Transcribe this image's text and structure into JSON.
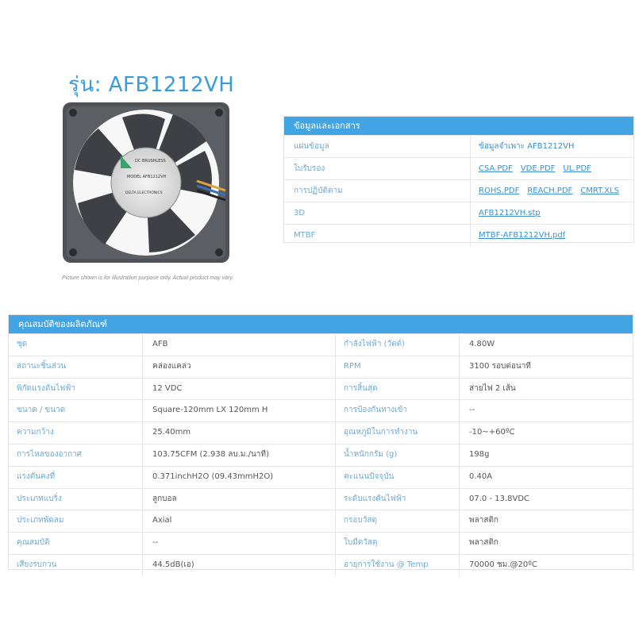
{
  "product": {
    "title": "รุ่น: AFB1212VH",
    "disclaimer": "Picture shown is for illustration purpose only. Actual product may vary.",
    "label_text": [
      "DC BRUSHLESS",
      "MODEL AFB1212VH",
      "DELTA ELECTRONICS"
    ]
  },
  "docs": {
    "header": "ข้อมูลและเอกสาร",
    "rows": [
      {
        "label": "แผ่นข้อมูล",
        "values": [
          "ข้อมูลจำเพาะ AFB1212VH"
        ],
        "links": false
      },
      {
        "label": "ใบรับรอง",
        "values": [
          "CSA.PDF",
          "VDE.PDF",
          "UL.PDF"
        ],
        "links": true
      },
      {
        "label": "การปฏิบัติตาม",
        "values": [
          "ROHS.PDF",
          "REACH.PDF",
          "CMRT.XLS"
        ],
        "links": true
      },
      {
        "label": "3D",
        "values": [
          "AFB1212VH.stp"
        ],
        "links": true
      },
      {
        "label": "MTBF",
        "values": [
          "MTBF-AFB1212VH.pdf"
        ],
        "links": true
      }
    ]
  },
  "props": {
    "header": "คุณสมบัติของผลิตภัณฑ์",
    "rows": [
      [
        "ชุด",
        "AFB",
        "กำลังไฟฟ้า (วัตต์)",
        "4.80W"
      ],
      [
        "สถานะชิ้นส่วน",
        "คล่องแคล่ว",
        "RPM",
        "3100 รอบต่อนาที"
      ],
      [
        "พิกัดแรงดันไฟฟ้า",
        "12 VDC",
        "การสิ้นสุด",
        "สายไฟ 2 เส้น"
      ],
      [
        "ขนาด / ขนาด",
        "Square-120mm LX 120mm H",
        "การป้องกันทางเข้า",
        "--"
      ],
      [
        "ความกว้าง",
        "25.40mm",
        "อุณหภูมิในการทำงาน",
        "-10~+60ºC"
      ],
      [
        "การไหลของอากาศ",
        "103.75CFM (2.938 ลบ.ม./นาที)",
        "น้ำหนักกรัม (g)",
        "198g"
      ],
      [
        "แรงดันคงที่",
        "0.371inchH2O (09.43mmH2O)",
        "คะแนนปัจจุบัน",
        "0.40A"
      ],
      [
        "ประเภทแบริ่ง",
        "ลูกบอล",
        "ระดับแรงดันไฟฟ้า",
        "07.0 - 13.8VDC"
      ],
      [
        "ประเภทพัดลม",
        "Axial",
        "กรอบวัสดุ",
        "พลาสติก"
      ],
      [
        "คุณสมบัติ",
        "--",
        "ใบมีดวัสดุ",
        "พลาสติก"
      ],
      [
        "เสียงรบกวน",
        "44.5dB(เอ)",
        "อายุการใช้งาน @ Temp",
        "70000 ชม.@20ºC"
      ]
    ]
  },
  "colors": {
    "accent": "#42a4e3",
    "label": "#6fa9d2",
    "link": "#3b8fcf"
  }
}
